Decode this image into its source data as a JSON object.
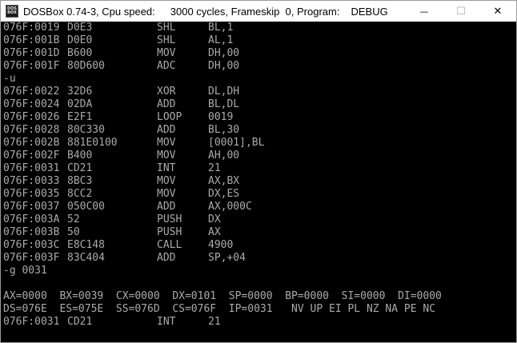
{
  "window": {
    "icon_text_top": "DOS",
    "icon_text_bottom": "BOX",
    "title_app": "DOSBox 0.74-3, Cpu speed:",
    "title_cycles": "3000 cycles, Frameskip  0, Program:",
    "title_program": "DEBUG",
    "minimize_symbol": "—",
    "maximize_symbol": "☐",
    "close_symbol": "✕"
  },
  "console": {
    "block1": [
      {
        "addr": "076F:0019",
        "hex": "D0E3",
        "mnemonic": "SHL",
        "operands": "BL,1"
      },
      {
        "addr": "076F:001B",
        "hex": "D0E0",
        "mnemonic": "SHL",
        "operands": "AL,1"
      },
      {
        "addr": "076F:001D",
        "hex": "B600",
        "mnemonic": "MOV",
        "operands": "DH,00"
      },
      {
        "addr": "076F:001F",
        "hex": "80D600",
        "mnemonic": "ADC",
        "operands": "DH,00"
      }
    ],
    "command_u": "-u",
    "block2": [
      {
        "addr": "076F:0022",
        "hex": "32D6",
        "mnemonic": "XOR",
        "operands": "DL,DH"
      },
      {
        "addr": "076F:0024",
        "hex": "02DA",
        "mnemonic": "ADD",
        "operands": "BL,DL"
      },
      {
        "addr": "076F:0026",
        "hex": "E2F1",
        "mnemonic": "LOOP",
        "operands": "0019"
      },
      {
        "addr": "076F:0028",
        "hex": "80C330",
        "mnemonic": "ADD",
        "operands": "BL,30"
      },
      {
        "addr": "076F:002B",
        "hex": "881E0100",
        "mnemonic": "MOV",
        "operands": "[0001],BL"
      },
      {
        "addr": "076F:002F",
        "hex": "B400",
        "mnemonic": "MOV",
        "operands": "AH,00"
      },
      {
        "addr": "076F:0031",
        "hex": "CD21",
        "mnemonic": "INT",
        "operands": "21"
      },
      {
        "addr": "076F:0033",
        "hex": "8BC3",
        "mnemonic": "MOV",
        "operands": "AX,BX"
      },
      {
        "addr": "076F:0035",
        "hex": "8CC2",
        "mnemonic": "MOV",
        "operands": "DX,ES"
      },
      {
        "addr": "076F:0037",
        "hex": "050C00",
        "mnemonic": "ADD",
        "operands": "AX,000C"
      },
      {
        "addr": "076F:003A",
        "hex": "52",
        "mnemonic": "PUSH",
        "operands": "DX"
      },
      {
        "addr": "076F:003B",
        "hex": "50",
        "mnemonic": "PUSH",
        "operands": "AX"
      },
      {
        "addr": "076F:003C",
        "hex": "E8C148",
        "mnemonic": "CALL",
        "operands": "4900"
      },
      {
        "addr": "076F:003F",
        "hex": "83C404",
        "mnemonic": "ADD",
        "operands": "SP,+04"
      }
    ],
    "command_g": "-g 0031",
    "registers_line1": "AX=0000  BX=0039  CX=0000  DX=0101  SP=0000  BP=0000  SI=0000  DI=0000",
    "registers_line2": "DS=076E  ES=075E  SS=076D  CS=076F  IP=0031   NV UP EI PL NZ NA PE NC",
    "current": {
      "addr": "076F:0031",
      "hex": "CD21",
      "mnemonic": "INT",
      "operands": "21"
    },
    "prompt": "-"
  }
}
